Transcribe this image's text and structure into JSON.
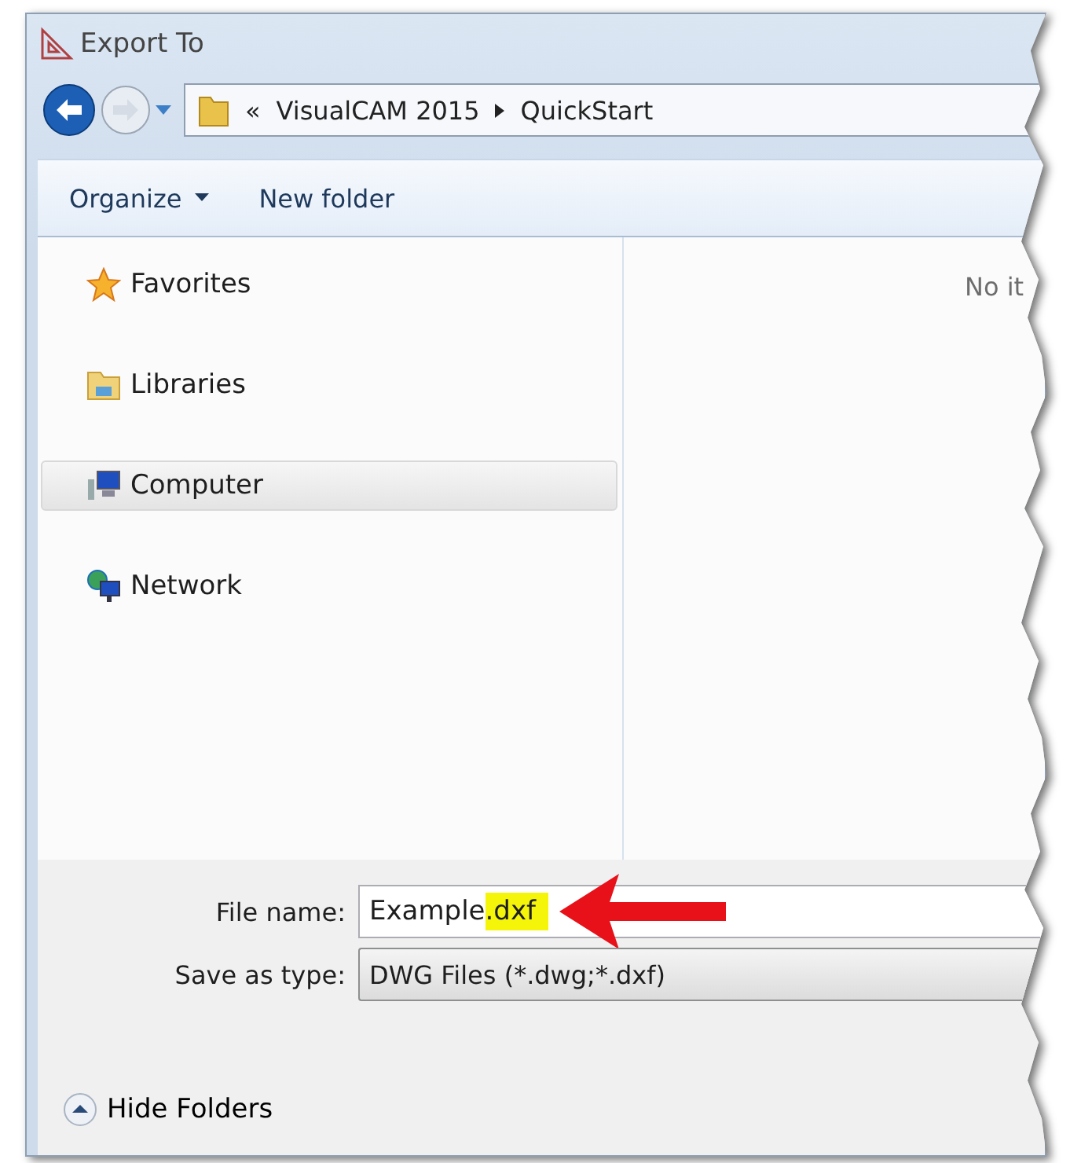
{
  "window": {
    "title": "Export To"
  },
  "address_bar": {
    "overflow": "«",
    "crumbs": [
      "VisualCAM 2015",
      "QuickStart"
    ]
  },
  "toolbar": {
    "organize": "Organize",
    "new_folder": "New folder"
  },
  "sidebar": {
    "items": [
      {
        "kind": "favorites",
        "label": "Favorites",
        "selected": false
      },
      {
        "kind": "libraries",
        "label": "Libraries",
        "selected": false
      },
      {
        "kind": "computer",
        "label": "Computer",
        "selected": true
      },
      {
        "kind": "network",
        "label": "Network",
        "selected": false
      }
    ]
  },
  "content": {
    "empty_message": "No it"
  },
  "file_name": {
    "label": "File name:",
    "value_parts": [
      {
        "text": "Example",
        "highlighted": false
      },
      {
        "text": ".dxf",
        "highlighted": true
      }
    ]
  },
  "save_as_type": {
    "label": "Save as type:",
    "value": "DWG Files (*.dwg;*.dxf)"
  },
  "hide_folders": {
    "label": "Hide Folders"
  }
}
